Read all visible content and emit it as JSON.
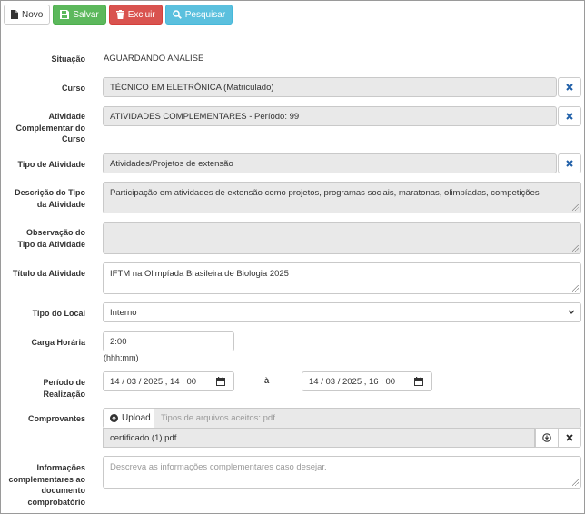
{
  "toolbar": {
    "novo_label": "Novo",
    "salvar_label": "Salvar",
    "excluir_label": "Excluir",
    "pesquisar_label": "Pesquisar"
  },
  "form": {
    "situacao": {
      "label": "Situação",
      "value": "AGUARDANDO ANÁLISE"
    },
    "curso": {
      "label": "Curso",
      "value": "TÉCNICO EM ELETRÔNICA (Matriculado)"
    },
    "atividade_complementar": {
      "label": "Atividade Complementar do Curso",
      "value": "ATIVIDADES COMPLEMENTARES - Período: 99"
    },
    "tipo_atividade": {
      "label": "Tipo de Atividade",
      "value": "Atividades/Projetos de extensão"
    },
    "descricao_tipo": {
      "label": "Descrição do Tipo da Atividade",
      "value": "Participação em atividades de extensão como projetos, programas sociais, maratonas, olimpíadas, competições"
    },
    "observacao_tipo": {
      "label": "Observação do Tipo da Atividade",
      "value": ""
    },
    "titulo": {
      "label": "Título da Atividade",
      "value": "IFTM na Olimpíada Brasileira de Biologia 2025"
    },
    "tipo_local": {
      "label": "Tipo do Local",
      "value": "Interno"
    },
    "carga_horaria": {
      "label": "Carga Horária",
      "value": "2:00",
      "hint": "(hhh:mm)"
    },
    "periodo": {
      "label": "Período de Realização",
      "start": "14 / 03 / 2025 ,  14 : 00",
      "separator": "à",
      "end": "14 / 03 / 2025 ,  16 : 00"
    },
    "comprovantes": {
      "label": "Comprovantes",
      "upload_label": "Upload",
      "placeholder": "Tipos de arquivos aceitos: pdf",
      "file_name": "certificado (1).pdf"
    },
    "informacoes": {
      "label": "Informações complementares ao documento comprobatório",
      "placeholder": "Descreva as informações complementares caso desejar."
    }
  },
  "colors": {
    "success": "#5cb85c",
    "danger": "#d9534f",
    "info": "#5bc0de",
    "readonly_bg": "#e9e9e9",
    "clear_icon": "#1f5fa8"
  },
  "icons": [
    "file-icon",
    "save-icon",
    "trash-icon",
    "search-icon",
    "close-icon",
    "chevron-down-icon",
    "calendar-icon",
    "upload-icon",
    "download-icon"
  ]
}
